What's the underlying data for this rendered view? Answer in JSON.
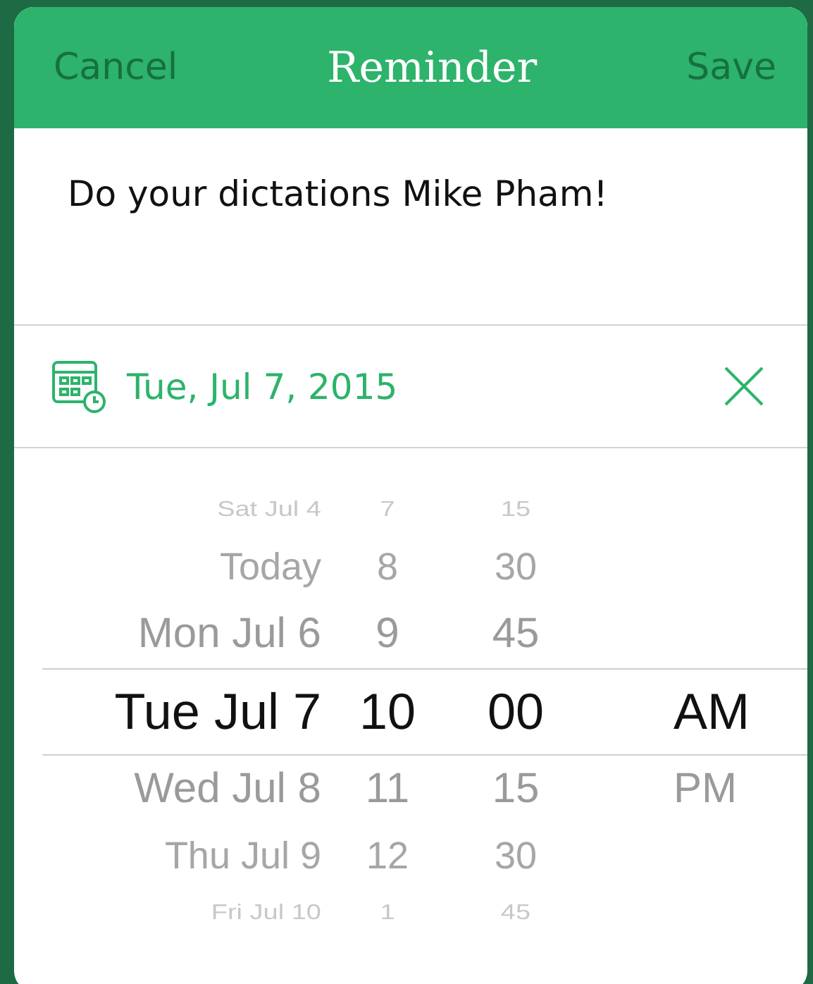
{
  "header": {
    "cancel": "Cancel",
    "title": "Reminder",
    "save": "Save"
  },
  "message": "Do your dictations Mike Pham!",
  "date_row": {
    "date": "Tue, Jul 7, 2015"
  },
  "picker": {
    "rows": [
      {
        "date": "Sat Jul 4",
        "hour": "7",
        "minute": "15",
        "selected": false
      },
      {
        "date": "Today",
        "hour": "8",
        "minute": "30",
        "selected": false
      },
      {
        "date": "Mon Jul 6",
        "hour": "9",
        "minute": "45",
        "selected": false
      },
      {
        "date": "Tue Jul 7",
        "hour": "10",
        "minute": "00",
        "meridiem": "AM",
        "selected": true
      },
      {
        "date": "Wed Jul 8",
        "hour": "11",
        "minute": "15",
        "meridiem": "PM",
        "selected": false
      },
      {
        "date": "Thu Jul 9",
        "hour": "12",
        "minute": "30",
        "selected": false
      },
      {
        "date": "Fri Jul 10",
        "hour": "1",
        "minute": "45",
        "selected": false
      }
    ]
  }
}
